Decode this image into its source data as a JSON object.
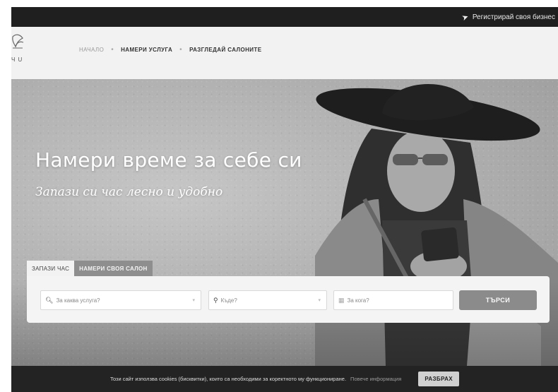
{
  "topbar": {
    "register_label": "Регистрирай своя бизнес",
    "register_icon": "paper-plane-icon"
  },
  "nav": {
    "logo_text": "Ч U",
    "items": [
      {
        "label": "НАЧАЛО"
      },
      {
        "label": "НАМЕРИ УСЛУГА"
      },
      {
        "label": "РАЗГЛЕДАЙ САЛОНИТЕ"
      }
    ]
  },
  "hero": {
    "title": "Намери време за себе си",
    "subtitle": "Запази си час лесно и удобно"
  },
  "search": {
    "tabs": [
      {
        "label": "ЗАПАЗИ ЧАС",
        "active": true
      },
      {
        "label": "НАМЕРИ СВОЯ САЛОН",
        "active": false
      }
    ],
    "service_placeholder": "За каква услуга?",
    "where_placeholder": "Къде?",
    "when_placeholder": "За кога?",
    "button_label": "ТЪРСИ"
  },
  "cookie": {
    "text": "Този сайт използва cookies (бисквитки), които са необходими за коректното му функциониране.",
    "more_label": "Повече информация",
    "accept_label": "РАЗБРАХ"
  },
  "colors": {
    "topbar_bg": "#1f1f1f",
    "search_button": "#8b8b8b",
    "cookie_bg": "#232323"
  }
}
